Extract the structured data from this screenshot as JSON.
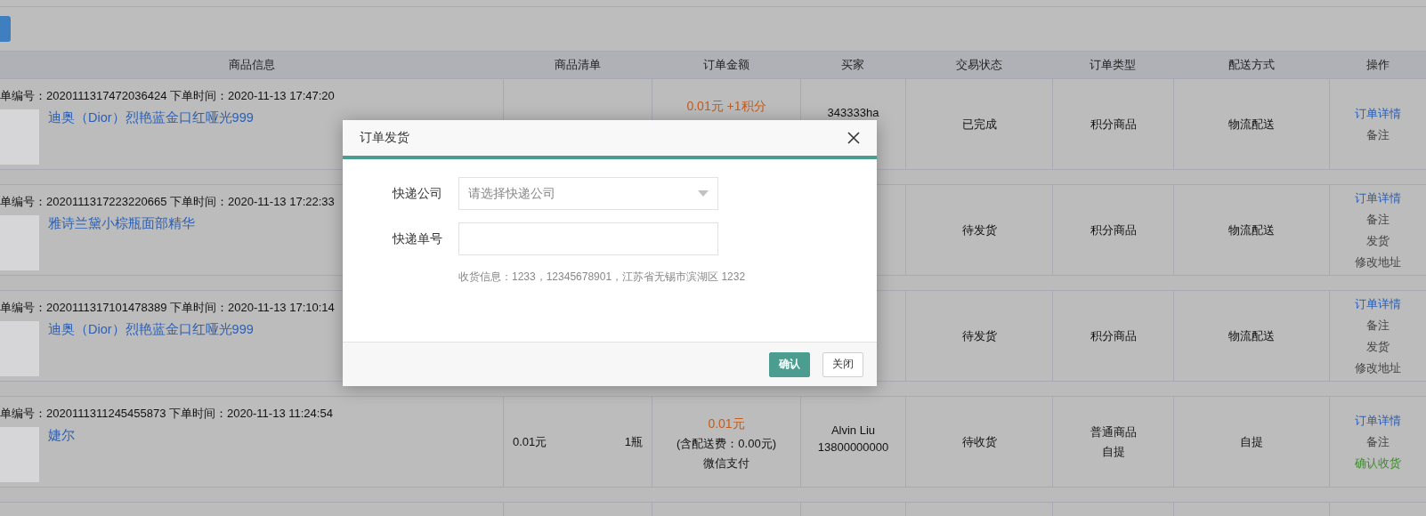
{
  "table": {
    "columns": [
      "商品信息",
      "商品清单",
      "订单金额",
      "买家",
      "交易状态",
      "订单类型",
      "配送方式",
      "操作"
    ],
    "orders": [
      {
        "order_line": "单编号：2020111317472036424 下单时间：2020-11-13 17:47:20",
        "product": "迪奥（Dior）烈艳蓝金口红哑光999",
        "amount": [
          "0.01元 +1积分"
        ],
        "buyer": [
          "343333ha"
        ],
        "status": "已完成",
        "type": [
          "积分商品"
        ],
        "delivery": "物流配送",
        "actions": [
          {
            "label": "订单详情",
            "kind": "link"
          },
          {
            "label": "备注",
            "kind": "plain"
          }
        ]
      },
      {
        "order_line": "单编号：2020111317223220665 下单时间：2020-11-13 17:22:33",
        "product": "雅诗兰黛小棕瓶面部精华",
        "status": "待发货",
        "type": [
          "积分商品"
        ],
        "delivery": "物流配送",
        "actions": [
          {
            "label": "订单详情",
            "kind": "link"
          },
          {
            "label": "备注",
            "kind": "plain"
          },
          {
            "label": "发货",
            "kind": "plain"
          },
          {
            "label": "修改地址",
            "kind": "plain"
          }
        ]
      },
      {
        "order_line": "单编号：2020111317101478389 下单时间：2020-11-13 17:10:14",
        "product": "迪奥（Dior）烈艳蓝金口红哑光999",
        "status": "待发货",
        "type": [
          "积分商品"
        ],
        "delivery": "物流配送",
        "actions": [
          {
            "label": "订单详情",
            "kind": "link"
          },
          {
            "label": "备注",
            "kind": "plain"
          },
          {
            "label": "发货",
            "kind": "plain"
          },
          {
            "label": "修改地址",
            "kind": "plain"
          }
        ]
      },
      {
        "order_line": "单编号：2020111311245455873 下单时间：2020-11-13 11:24:54",
        "product": "婕尔",
        "items": {
          "price": "0.01元",
          "qty": "1瓶"
        },
        "amount": [
          "0.01元",
          "(含配送费：0.00元)",
          "微信支付"
        ],
        "buyer": [
          "Alvin Liu",
          "13800000000"
        ],
        "status": "待收货",
        "type": [
          "普通商品",
          "自提"
        ],
        "delivery": "自提",
        "actions": [
          {
            "label": "订单详情",
            "kind": "link"
          },
          {
            "label": "备注",
            "kind": "plain"
          },
          {
            "label": "确认收货",
            "kind": "confirm"
          }
        ]
      }
    ]
  },
  "dialog": {
    "title": "订单发货",
    "fields": [
      {
        "label": "快递公司",
        "kind": "select",
        "placeholder": "请选择快递公司"
      },
      {
        "label": "快递单号",
        "kind": "text"
      }
    ],
    "hint": "收货信息：1233，12345678901，江苏省无锡市滨湖区 1232",
    "buttons": [
      {
        "label": "确认",
        "kind": "primary"
      },
      {
        "label": "关闭",
        "kind": "default"
      }
    ]
  }
}
